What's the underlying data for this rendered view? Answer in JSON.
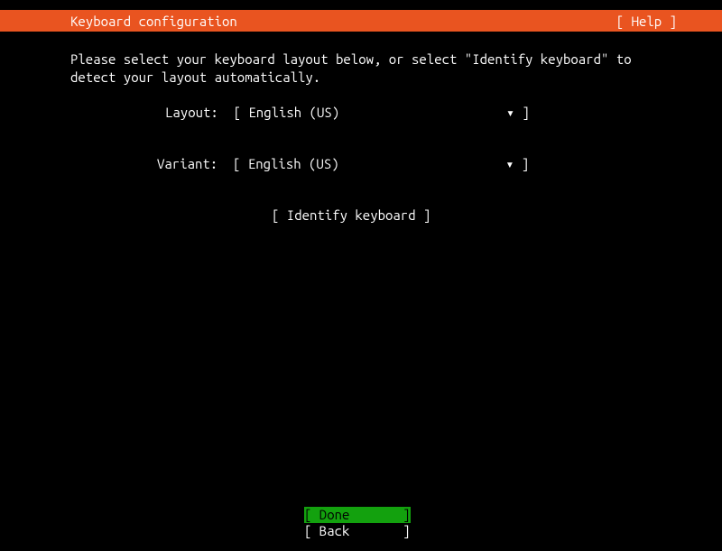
{
  "header": {
    "title": "Keyboard configuration",
    "help": "[ Help ]"
  },
  "instruction": "Please select your keyboard layout below, or select \"Identify keyboard\" to\ndetect your layout automatically.",
  "fields": {
    "layout": {
      "label": "Layout:  ",
      "value": "[ English (US)                      ",
      "arrow": "▾ ]"
    },
    "variant": {
      "label": "Variant:  ",
      "value": "[ English (US)                      ",
      "arrow": "▾ ]"
    }
  },
  "identify_button": "[ Identify keyboard ]",
  "footer": {
    "done": "[ Done       ]",
    "back": "[ Back       ]"
  }
}
